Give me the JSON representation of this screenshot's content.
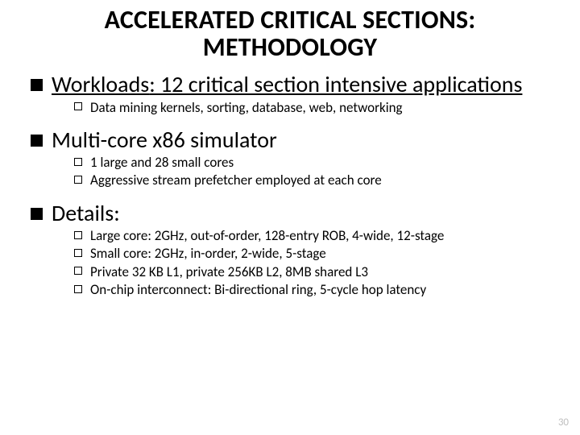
{
  "title_line1": "ACCELERATED CRITICAL SECTIONS:",
  "title_line2": "METHODOLOGY",
  "sections": [
    {
      "head_plain": "Workloads",
      "head_rest": ": 12 critical section intensive applications",
      "underline": true,
      "subs": [
        "Data mining kernels, sorting, database, web, networking"
      ]
    },
    {
      "head_plain": "Multi-core x86 simulator",
      "head_rest": "",
      "underline": false,
      "subs": [
        "1 large and 28 small cores",
        "Aggressive stream prefetcher employed at each core"
      ]
    },
    {
      "head_plain": "Details:",
      "head_rest": "",
      "underline": false,
      "subs": [
        "Large core: 2GHz, out-of-order, 128-entry ROB, 4-wide, 12-stage",
        "Small core: 2GHz, in-order, 2-wide, 5-stage",
        "Private 32 KB L1, private 256KB L2, 8MB shared L3",
        "On-chip interconnect: Bi-directional ring, 5-cycle hop latency"
      ]
    }
  ],
  "page_number": "30"
}
